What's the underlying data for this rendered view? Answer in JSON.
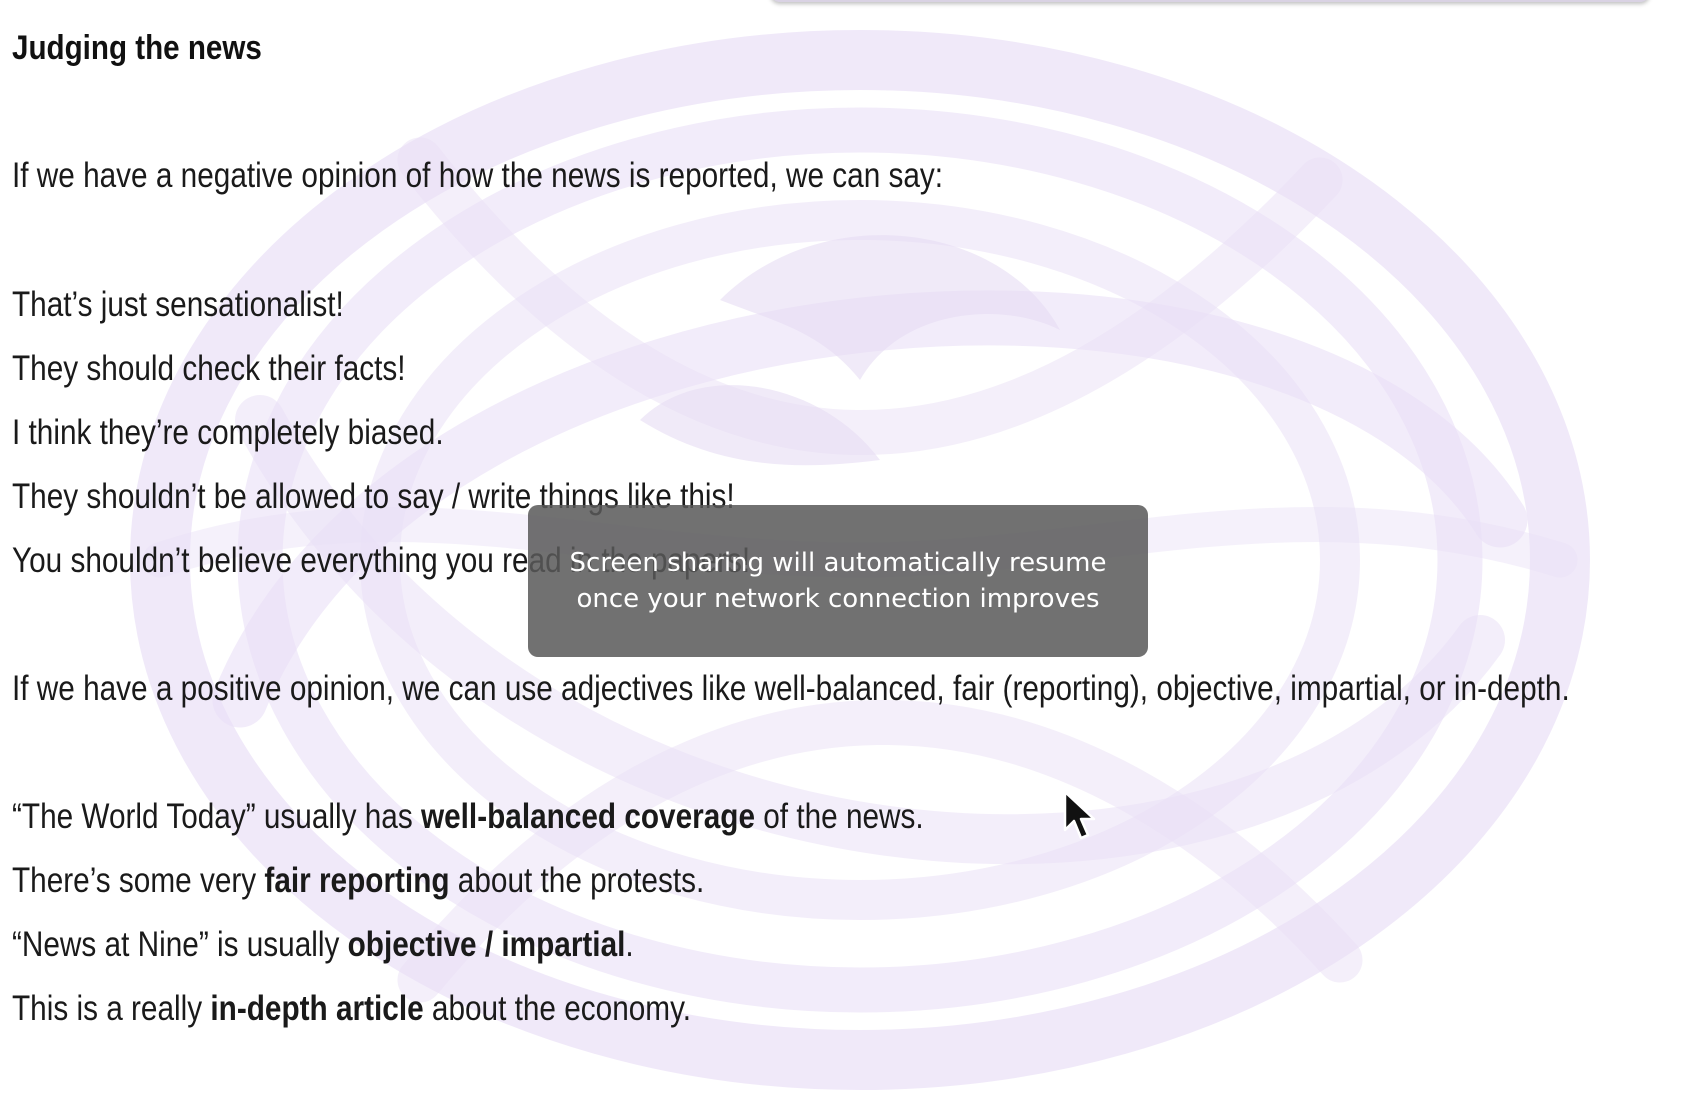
{
  "slide": {
    "heading": "Judging the news",
    "intro_negative": "If we have a negative opinion of how the news is reported, we can say:",
    "negative_phrases": [
      "That’s just sensationalist!",
      "They should check their facts!",
      "I think they’re completely biased.",
      "They shouldn’t be allowed to say / write things like this!",
      "You shouldn’t believe everything you read in the papers!"
    ],
    "intro_positive": "If we have a positive opinion, we can use adjectives like well-balanced, fair (reporting), objective, impartial, or in-depth.",
    "examples": [
      {
        "pre": "“The World Today” usually has ",
        "bold": "well-balanced coverage",
        "post": " of the news."
      },
      {
        "pre": "There’s some very ",
        "bold": "fair reporting",
        "post": " about the protests."
      },
      {
        "pre": "“News at Nine” is usually ",
        "bold": "objective / impartial",
        "post": "."
      },
      {
        "pre": "This is a really ",
        "bold": "in-depth article",
        "post": " about the economy."
      }
    ]
  },
  "notification": {
    "line1": "Screen sharing will automatically resume",
    "line2": "once your network connection improves"
  },
  "icons": {
    "cursor": "mouse-pointer-icon",
    "background": "celtic-knot-emblem"
  },
  "colors": {
    "emblem": "#e7ddf5",
    "toast_bg": "#5a5a5a",
    "text": "#1a1a1a"
  }
}
